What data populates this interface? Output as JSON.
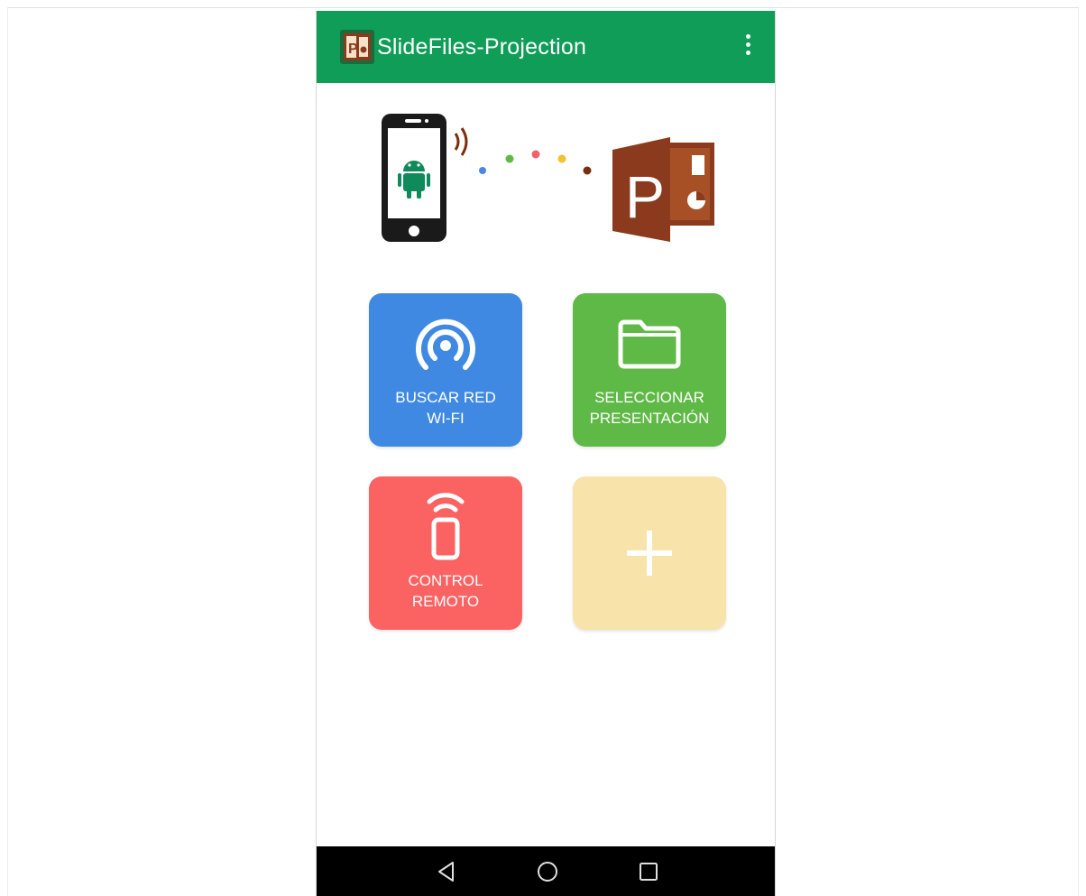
{
  "app": {
    "title": "SlideFiles-Projection"
  },
  "tiles": [
    {
      "label": "BUSCAR RED\nWI-FI",
      "color": "#3f89e3",
      "icon": "wifi-hotspot-icon"
    },
    {
      "label": "SELECCIONAR\nPRESENTACIÓN",
      "color": "#5fb946",
      "icon": "folder-icon"
    },
    {
      "label": "CONTROL\nREMOTO",
      "color": "#fb6262",
      "icon": "remote-phone-icon"
    },
    {
      "label": "",
      "color": "#f8e4aa",
      "icon": "plus-icon"
    }
  ],
  "colors": {
    "appbar": "#0f9d58",
    "powerpoint_brown": "#8b3a1d"
  },
  "navbar": {
    "buttons": [
      "back-icon",
      "home-icon",
      "recents-icon"
    ]
  }
}
